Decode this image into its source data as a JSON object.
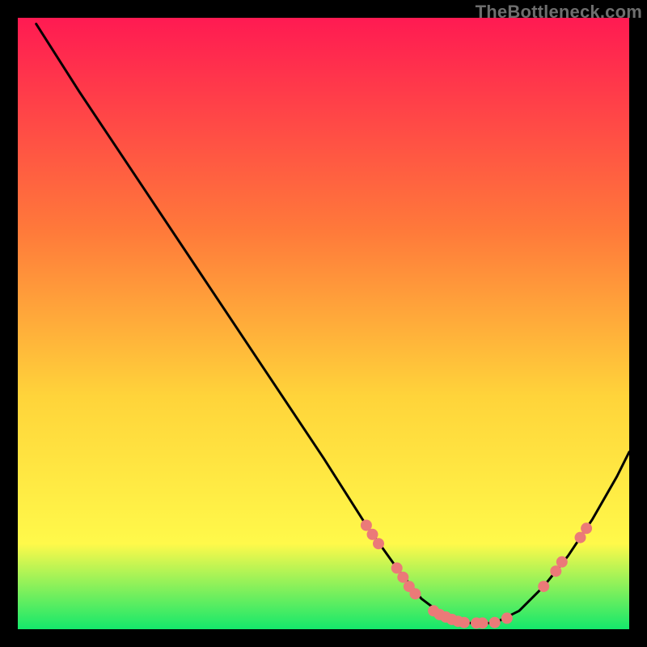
{
  "watermark": "TheBottleneck.com",
  "colors": {
    "gradient_top": "#ff1a52",
    "gradient_mid1": "#ff7a3a",
    "gradient_mid2": "#ffd43a",
    "gradient_mid3": "#fff94a",
    "gradient_bottom": "#14e86b",
    "curve": "#000000",
    "marker": "#eb7a78",
    "frame": "#000000"
  },
  "chart_data": {
    "type": "line",
    "title": "",
    "xlabel": "",
    "ylabel": "",
    "xlim": [
      0,
      100
    ],
    "ylim": [
      0,
      100
    ],
    "grid": false,
    "legend": false,
    "series": [
      {
        "name": "bottleneck-curve",
        "x": [
          3,
          10,
          20,
          30,
          40,
          50,
          57,
          62,
          66,
          70,
          74,
          78,
          82,
          86,
          90,
          94,
          98,
          100
        ],
        "y": [
          99,
          88,
          73,
          58,
          43,
          28,
          17,
          10,
          5,
          2,
          1,
          1,
          3,
          7,
          12,
          18,
          25,
          29
        ]
      }
    ],
    "markers": {
      "name": "highlighted-points",
      "points": [
        {
          "x": 57,
          "y": 17
        },
        {
          "x": 58,
          "y": 15.5
        },
        {
          "x": 59,
          "y": 14
        },
        {
          "x": 62,
          "y": 10
        },
        {
          "x": 63,
          "y": 8.5
        },
        {
          "x": 64,
          "y": 7
        },
        {
          "x": 65,
          "y": 5.8
        },
        {
          "x": 68,
          "y": 3
        },
        {
          "x": 69,
          "y": 2.4
        },
        {
          "x": 70,
          "y": 2
        },
        {
          "x": 71,
          "y": 1.6
        },
        {
          "x": 72,
          "y": 1.3
        },
        {
          "x": 73,
          "y": 1.1
        },
        {
          "x": 75,
          "y": 1
        },
        {
          "x": 76,
          "y": 1
        },
        {
          "x": 78,
          "y": 1.1
        },
        {
          "x": 80,
          "y": 1.8
        },
        {
          "x": 86,
          "y": 7
        },
        {
          "x": 88,
          "y": 9.5
        },
        {
          "x": 89,
          "y": 11
        },
        {
          "x": 92,
          "y": 15
        },
        {
          "x": 93,
          "y": 16.5
        }
      ]
    }
  }
}
